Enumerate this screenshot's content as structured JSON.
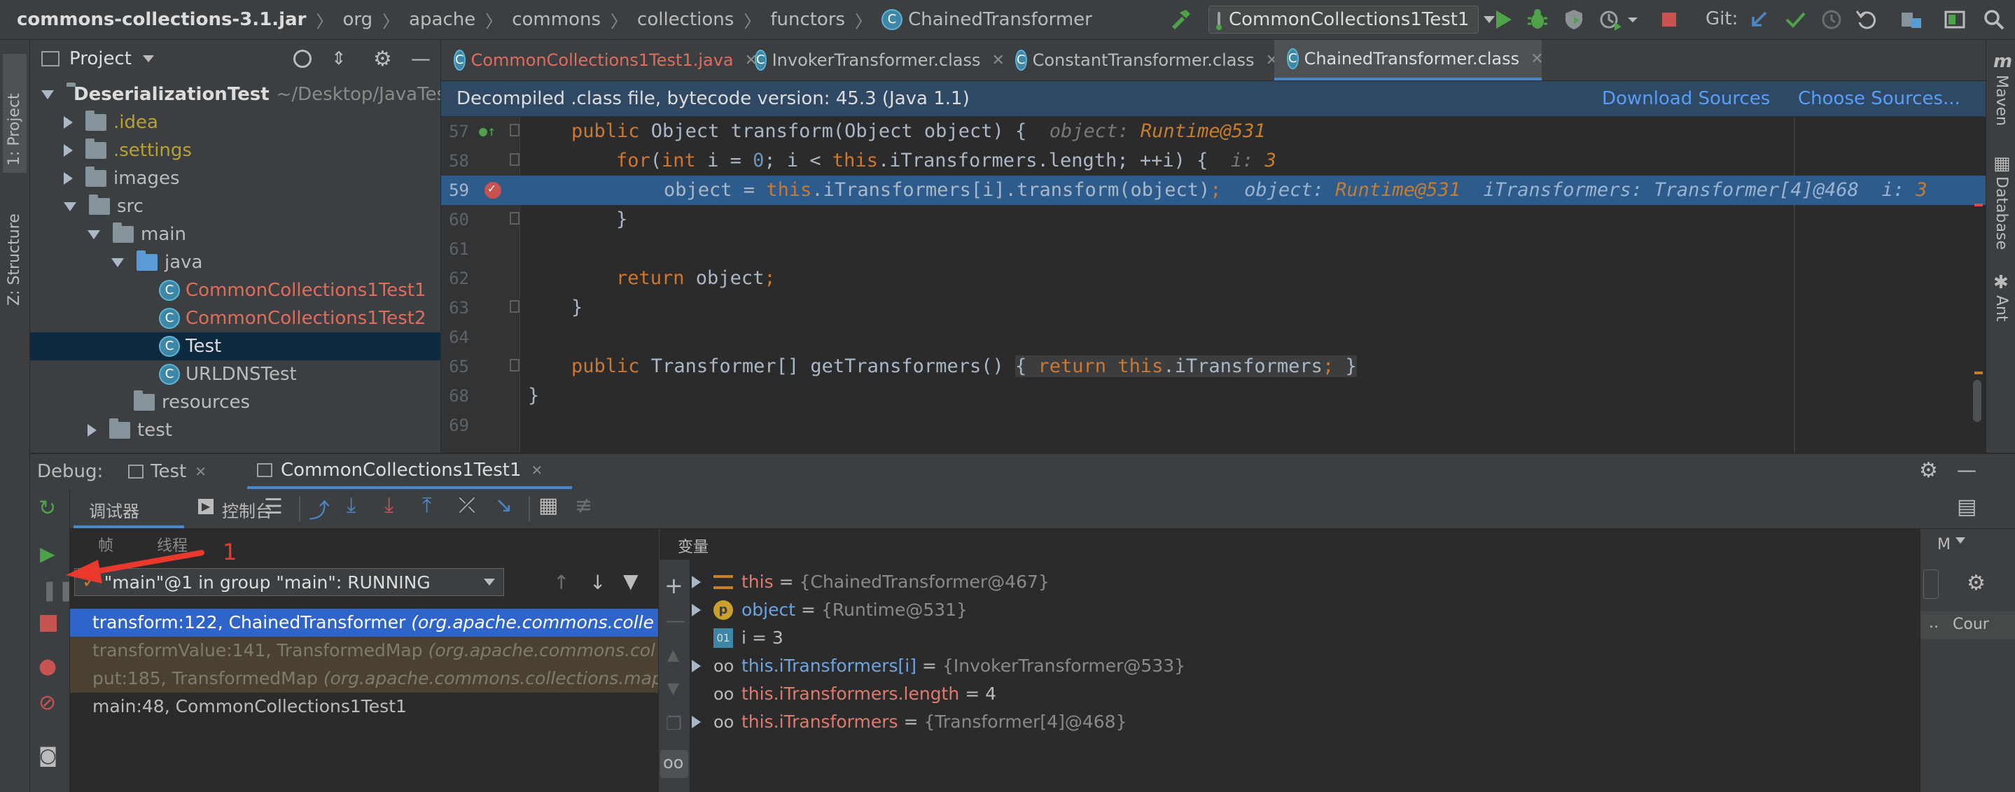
{
  "navbar": {
    "crumbs": [
      "commons-collections-3.1.jar",
      "org",
      "apache",
      "commons",
      "collections",
      "functors",
      "ChainedTransformer"
    ],
    "run_config": "CommonCollections1Test1",
    "git_label": "Git:"
  },
  "left_strip": {
    "project_tab": "1: Project",
    "structure_tab": "Z: Structure"
  },
  "right_strip": {
    "maven_tab": "Maven",
    "database_tab": "Database",
    "ant_tab": "Ant"
  },
  "project": {
    "title": "Project",
    "tree": [
      {
        "label": "DeserializationTest",
        "suffix": "~/Desktop/JavaTes"
      },
      {
        "label": ".idea"
      },
      {
        "label": ".settings"
      },
      {
        "label": "images"
      },
      {
        "label": "src"
      },
      {
        "label": "main"
      },
      {
        "label": "java"
      },
      {
        "label": "CommonCollections1Test1"
      },
      {
        "label": "CommonCollections1Test2"
      },
      {
        "label": "Test"
      },
      {
        "label": "URLDNSTest"
      },
      {
        "label": "resources"
      },
      {
        "label": "test"
      }
    ]
  },
  "editor": {
    "tabs": [
      {
        "label": "CommonCollections1Test1.java"
      },
      {
        "label": "InvokerTransformer.class"
      },
      {
        "label": "ConstantTransformer.class"
      },
      {
        "label": "ChainedTransformer.class"
      }
    ],
    "banner": {
      "text": "Decompiled .class file, bytecode version: 45.3 (Java 1.1)",
      "download": "Download Sources",
      "choose": "Choose Sources..."
    },
    "line_numbers": [
      "57",
      "58",
      "59",
      "60",
      "61",
      "62",
      "63",
      "64",
      "65",
      "68",
      "69"
    ],
    "code": {
      "l57a": "public",
      "l57b": " Object transform(Object object) {",
      "l57h": "object:",
      "l57v": "Runtime@531",
      "l58a": "for",
      "l58b": "(",
      "l58c": "int",
      "l58d": " i = ",
      "l58e": "0",
      "l58f": "; i < ",
      "l58g": "this",
      "l58h": ".iTransformers.length",
      "l58i": "; ++i) {",
      "l58hint": "i:",
      "l58val": "3",
      "l59a": "object = ",
      "l59b": "this",
      "l59c": ".iTransformers[i].transform(object)",
      "l59d": ";",
      "l59h1": "object:",
      "l59v1": "Runtime@531",
      "l59h2": "iTransformers:",
      "l59v2": "Transformer[4]@468",
      "l59h3": "i:",
      "l59v3": "3",
      "l60": "}",
      "l62a": "return",
      "l62b": " object",
      "l62c": ";",
      "l63": "}",
      "l65a": "public",
      "l65b": " Transformer[] getTransformers()",
      "l65c": "{",
      "l65d": "return",
      "l65e": "this",
      "l65f": ".iTransformers",
      "l65g": ";",
      "l65h": "}",
      "l68": "}"
    }
  },
  "debug": {
    "label": "Debug:",
    "tabs": [
      {
        "label": "Test"
      },
      {
        "label": "CommonCollections1Test1"
      }
    ],
    "tool_tabs": {
      "debugger": "调试器",
      "console": "控制台"
    },
    "subtabs": {
      "frames": "帧",
      "threads": "线程"
    },
    "thread": "\"main\"@1 in group \"main\": RUNNING",
    "frames": [
      {
        "method": "transform:122, ChainedTransformer",
        "pkg": "(org.apache.commons.colle"
      },
      {
        "method": "transformValue:141, TransformedMap",
        "pkg": "(org.apache.commons.col"
      },
      {
        "method": "put:185, TransformedMap",
        "pkg": "(org.apache.commons.collections.map"
      },
      {
        "method": "main:48, CommonCollections1Test1",
        "pkg": ""
      }
    ],
    "vars_title": "变量",
    "variables": [
      {
        "name": "this",
        "value": "{ChainedTransformer@467}"
      },
      {
        "name": "object",
        "value": "{Runtime@531}"
      },
      {
        "name": "i",
        "value": "3"
      },
      {
        "name": "this.iTransformers[i]",
        "value": "{InvokerTransformer@533}"
      },
      {
        "name": "this.iTransformers.length",
        "value": "4"
      },
      {
        "name": "this.iTransformers",
        "value": "{Transformer[4]@468}"
      }
    ],
    "watch_label": "M",
    "watch_col": "Cour",
    "watch_dots": "..",
    "annotation": "1"
  },
  "colors": {
    "accent": "#2f65ca",
    "editor_highlight": "#2d5b8c",
    "annotation_red": "#e8392c",
    "run_green": "#4fa24a"
  }
}
